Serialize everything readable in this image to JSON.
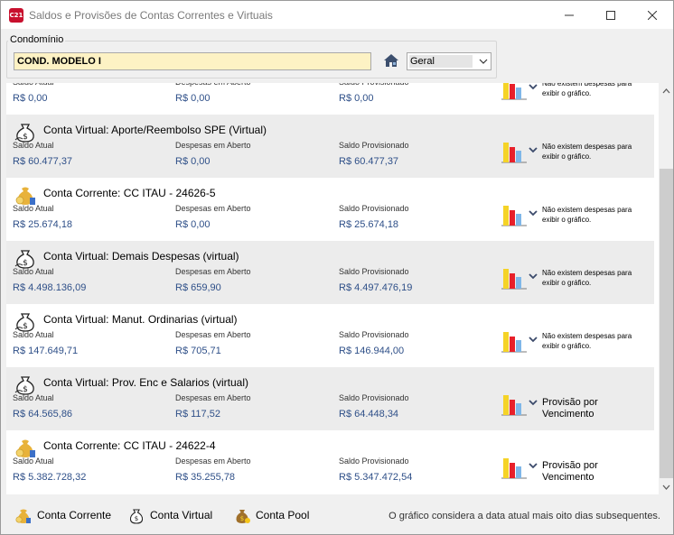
{
  "window": {
    "title": "Saldos e Provisões de Contas Correntes e Virtuais",
    "app_icon": "C21"
  },
  "condominio": {
    "label": "Condomínio",
    "value": "COND. MODELO I",
    "filter_value": "Geral"
  },
  "columns": {
    "saldo": "Saldo Atual",
    "despesas": "Despesas em Aberto",
    "provisionado": "Saldo Provisionado"
  },
  "rows": [
    {
      "title": "",
      "type": "virtual",
      "saldo": "R$ 0,00",
      "despesas": "R$ 0,00",
      "provisionado": "R$ 0,00",
      "chart_note": "Não existem despesas para exibir o gráfico.",
      "shaded": false
    },
    {
      "title": "Conta Virtual: Aporte/Reembolso SPE (Virtual)",
      "type": "virtual",
      "saldo": "R$ 60.477,37",
      "despesas": "R$ 0,00",
      "provisionado": "R$ 60.477,37",
      "chart_note": "Não existem despesas para exibir o gráfico.",
      "shaded": true
    },
    {
      "title": "Conta Corrente: CC ITAU - 24626-5",
      "type": "corrente",
      "saldo": "R$ 25.674,18",
      "despesas": "R$ 0,00",
      "provisionado": "R$ 25.674,18",
      "chart_note": "Não existem despesas para exibir o gráfico.",
      "shaded": false
    },
    {
      "title": "Conta Virtual: Demais Despesas (virtual)",
      "type": "virtual",
      "saldo": "R$ 4.498.136,09",
      "despesas": "R$ 659,90",
      "provisionado": "R$ 4.497.476,19",
      "chart_note": "Não existem despesas para exibir o gráfico.",
      "shaded": true
    },
    {
      "title": "Conta Virtual: Manut. Ordinarias (virtual)",
      "type": "virtual",
      "saldo": "R$ 147.649,71",
      "despesas": "R$ 705,71",
      "provisionado": "R$ 146.944,00",
      "chart_note": "Não existem despesas para exibir o gráfico.",
      "shaded": false
    },
    {
      "title": "Conta Virtual: Prov. Enc e Salarios (virtual)",
      "type": "virtual",
      "saldo": "R$ 64.565,86",
      "despesas": "R$ 117,52",
      "provisionado": "R$ 64.448,34",
      "chart_note": "Provisão por Vencimento",
      "shaded": true
    },
    {
      "title": "Conta Corrente: CC ITAU - 24622-4",
      "type": "corrente",
      "saldo": "R$ 5.382.728,32",
      "despesas": "R$ 35.255,78",
      "provisionado": "R$ 5.347.472,54",
      "chart_note": "Provisão por Vencimento",
      "shaded": false
    }
  ],
  "legend": {
    "corrente": "Conta Corrente",
    "virtual": "Conta Virtual",
    "pool": "Conta Pool"
  },
  "footer_note": "O gráfico considera a data atual mais oito dias subsequentes.",
  "colors": {
    "value_text": "#2e4f88",
    "row_shade": "#ececec",
    "input_bg": "#fdf2c4",
    "chart_yellow": "#f5d327",
    "chart_red": "#e8202a",
    "chart_blue": "#7fb7e8"
  },
  "icons": {
    "bag_virtual": "money-bag-outline-icon",
    "bag_corrente": "coin-bag-icon",
    "bag_pool": "gold-bag-icon",
    "chart": "bar-chart-icon",
    "house": "house-icon"
  }
}
